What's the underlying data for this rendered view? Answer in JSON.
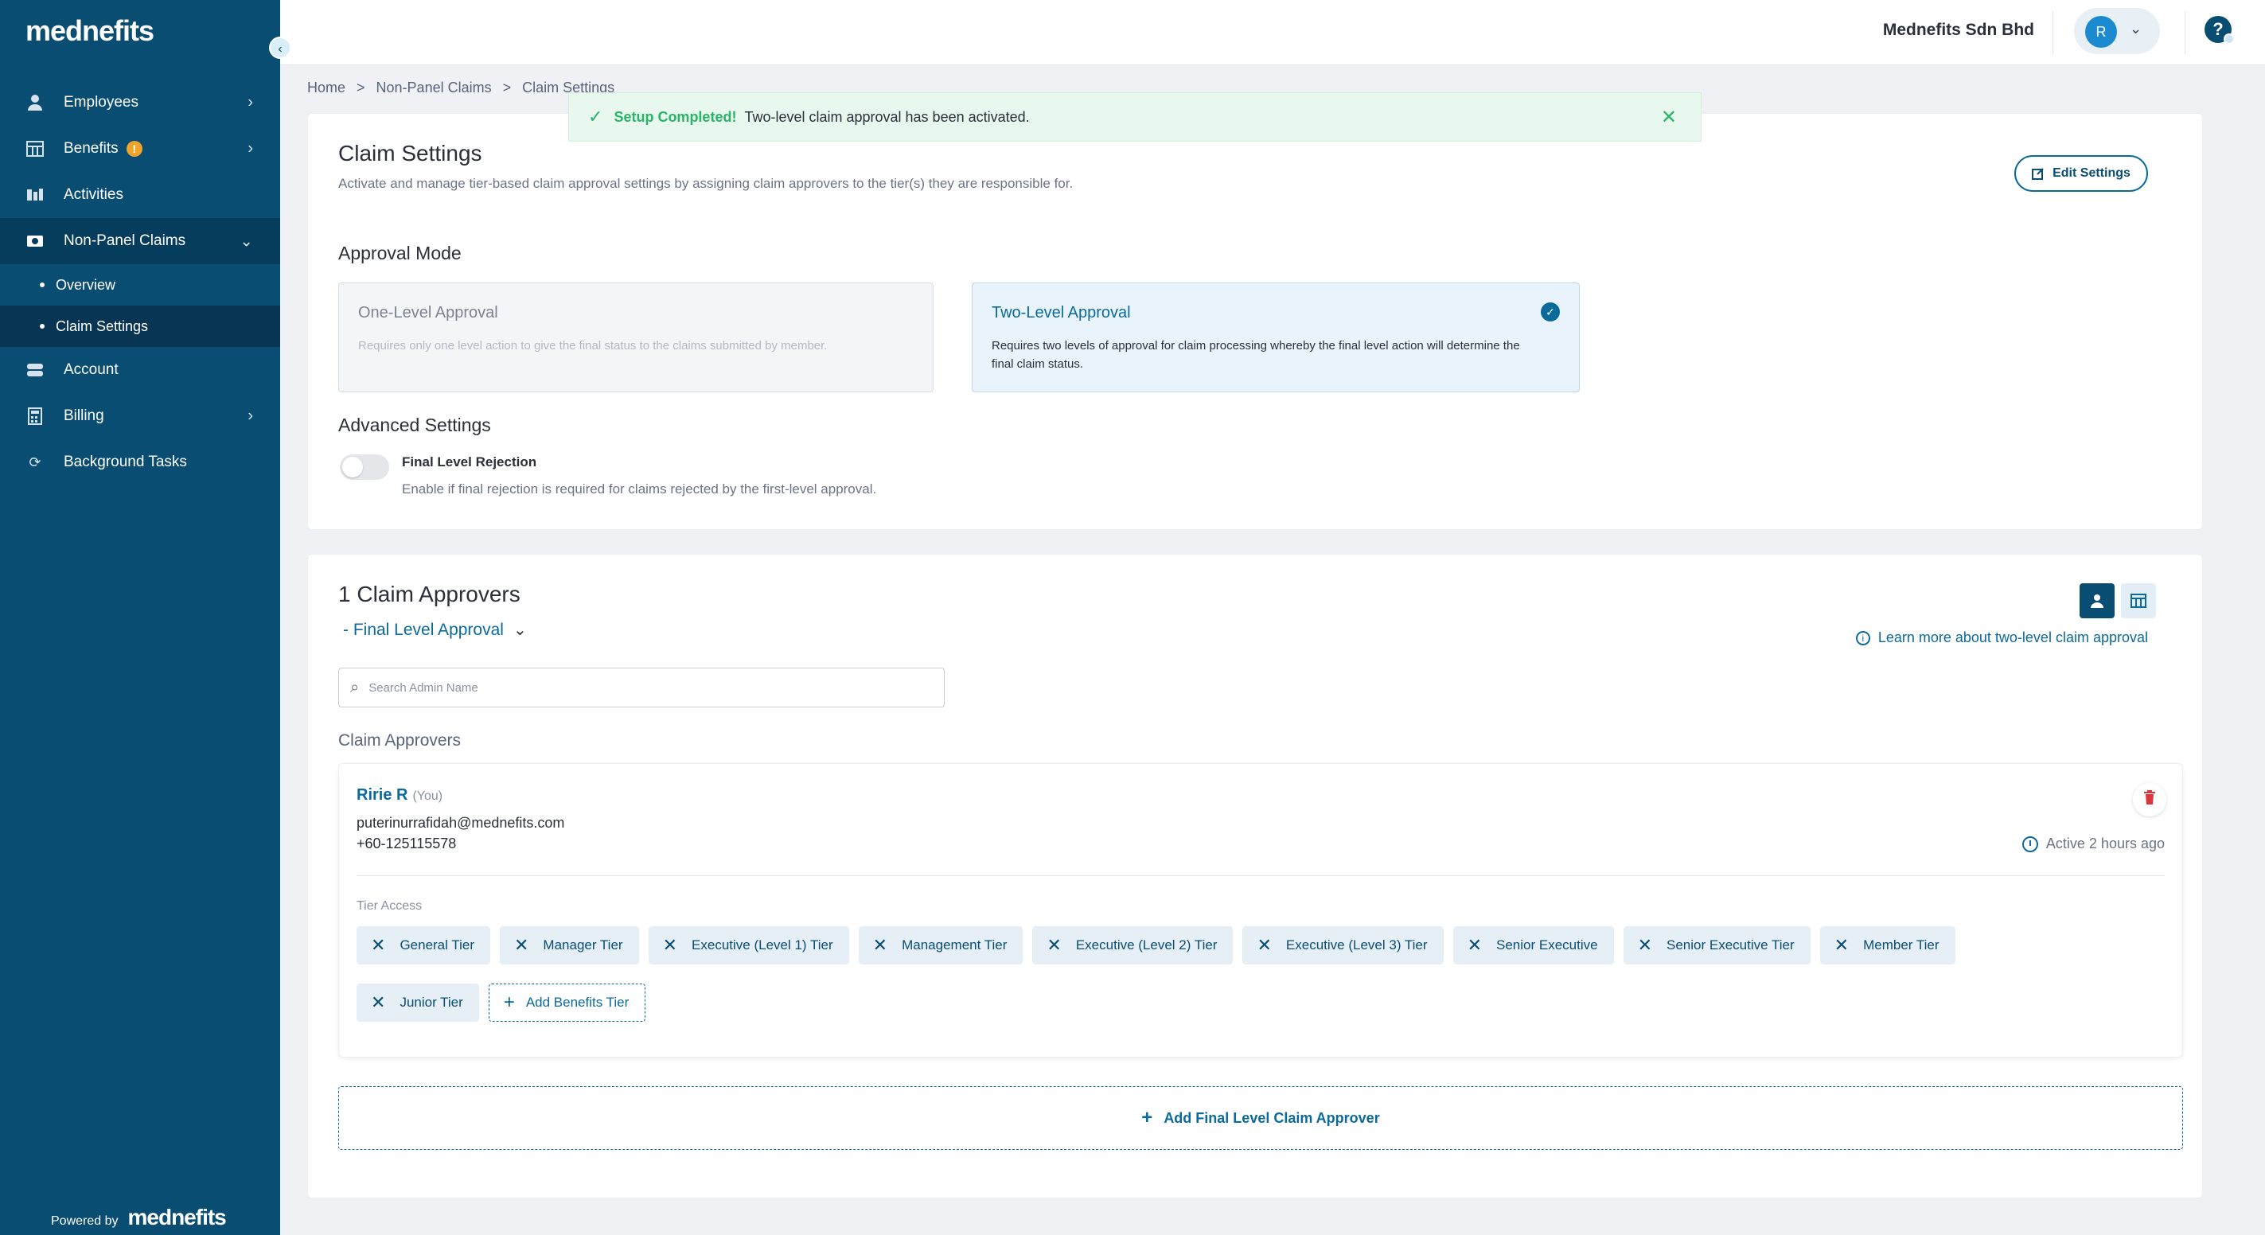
{
  "brand": {
    "logo": "mednefits",
    "powered_by": "Powered by",
    "accent": "#0a4d73"
  },
  "sidebar": {
    "items": [
      {
        "label": "Employees",
        "icon": "person-icon"
      },
      {
        "label": "Benefits",
        "icon": "benefits-icon",
        "badge": "!"
      },
      {
        "label": "Activities",
        "icon": "activities-icon"
      },
      {
        "label": "Non-Panel Claims",
        "icon": "claims-icon"
      },
      {
        "label": "Account",
        "icon": "account-icon"
      },
      {
        "label": "Billing",
        "icon": "billing-icon"
      },
      {
        "label": "Background Tasks",
        "icon": "sync-icon"
      }
    ],
    "sub_items": [
      {
        "label": "Overview"
      },
      {
        "label": "Claim Settings"
      }
    ]
  },
  "topbar": {
    "company": "Mednefits Sdn Bhd",
    "avatar_initial": "R",
    "help": "?"
  },
  "breadcrumb": {
    "items": [
      "Home",
      "Non-Panel Claims",
      "Claim Settings"
    ],
    "sep": ">"
  },
  "toast": {
    "strong": "Setup Completed!",
    "message": "Two-level claim approval has been activated.",
    "color": "#29b467"
  },
  "settings": {
    "title": "Claim Settings",
    "subtitle": "Activate and manage tier-based claim approval settings by assigning claim approvers to the tier(s) they are responsible for.",
    "edit_label": "Edit Settings",
    "approval_mode_title": "Approval Mode",
    "modes": [
      {
        "title": "One-Level Approval",
        "desc": "Requires only one level action to give the final status to the claims submitted by member.",
        "selected": false
      },
      {
        "title": "Two-Level Approval",
        "desc": "Requires two levels of approval for claim processing whereby the final level action will determine the final claim status.",
        "selected": true
      }
    ],
    "advanced_title": "Advanced Settings",
    "toggle_label": "Final Level Rejection",
    "toggle_desc": "Enable if final rejection is required for claims rejected by the first-level approval.",
    "toggle_on": false
  },
  "approvers": {
    "title": "1 Claim Approvers",
    "filter": "- Final Level Approval",
    "learn_more": "Learn more about two-level claim approval",
    "search_placeholder": "Search Admin Name",
    "list_label": "Claim Approvers",
    "approver": {
      "name": "Ririe R",
      "you": "(You)",
      "email": "puterinurrafidah@mednefits.com",
      "phone": "+60-125115578",
      "active": "Active 2 hours ago",
      "tier_access_label": "Tier Access",
      "tiers": [
        "General Tier",
        "Manager Tier",
        "Executive (Level 1) Tier",
        "Management Tier",
        "Executive (Level 2) Tier",
        "Executive (Level 3) Tier",
        "Senior Executive",
        "Senior Executive Tier",
        "Member Tier",
        "Junior Tier"
      ],
      "add_tier_label": "Add Benefits Tier"
    },
    "add_approver_label": "Add Final Level Claim Approver"
  }
}
